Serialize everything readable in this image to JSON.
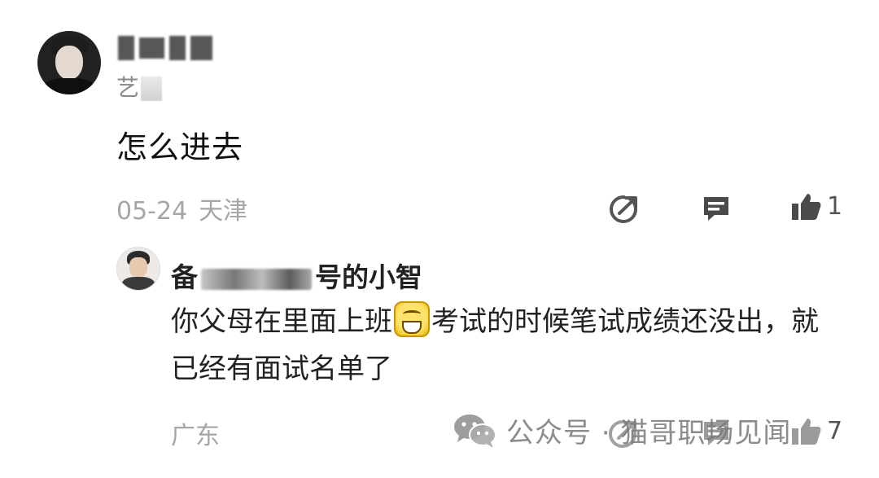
{
  "comment": {
    "user_tag": "艺",
    "text": "怎么进去",
    "date": "05-24",
    "location": "天津",
    "like_count": "1",
    "icons": {
      "share": "share-icon",
      "reply": "reply-icon",
      "like": "thumbs-up-icon"
    }
  },
  "reply": {
    "name_prefix": "备",
    "name_suffix": "号的小智",
    "text_before_emoji": "你父母在里面上班",
    "emoji": "grinning-emoji",
    "text_after_emoji": "考试的时候笔试成绩还没出，就已经有面试名单了",
    "location": "广东",
    "like_count": "7"
  },
  "watermark": {
    "text": "公众号 · 猫哥职场见闻",
    "icon": "wechat-icon"
  },
  "colors": {
    "text": "#111111",
    "meta": "#a6a6a6",
    "icon": "#4a4a4a"
  }
}
